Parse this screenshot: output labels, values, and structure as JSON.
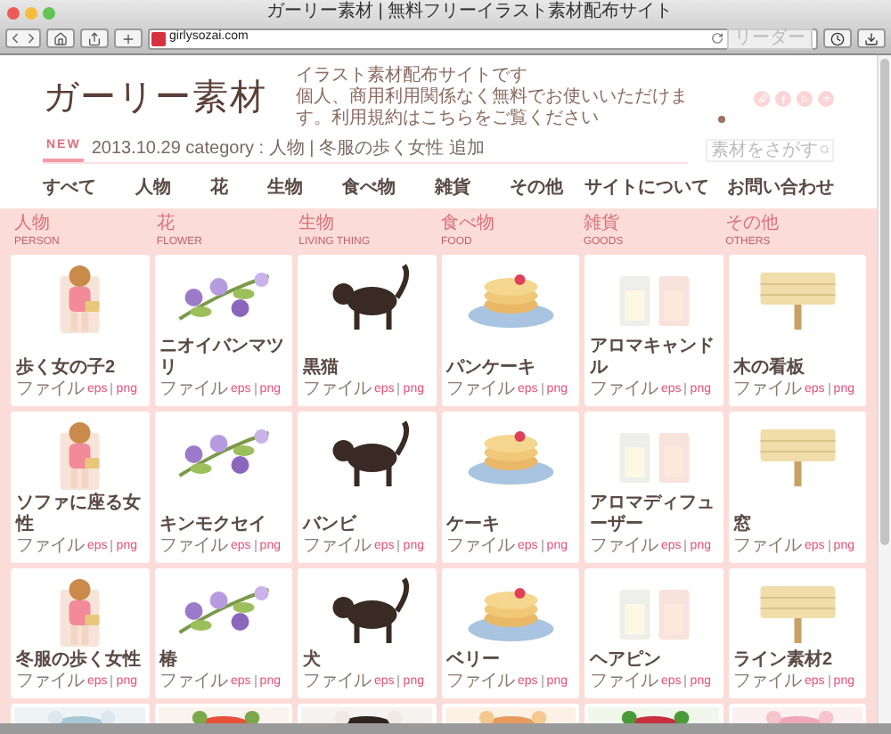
{
  "browser": {
    "title": "ガーリー素材 | 無料フリーイラスト素材配布サイト",
    "url": "girlysozai.com",
    "reader_button": "リーダー"
  },
  "header": {
    "logo": "ガーリー素材",
    "tagline": [
      "イラスト素材配布サイトです",
      "個人、商用利用関係なく無料でお使いいただけます。利用規約はこちらをご覧ください"
    ]
  },
  "news": {
    "badge": "NEW",
    "text": "2013.10.29 category : 人物 | 冬服の歩く女性 追加"
  },
  "search": {
    "placeholder": "素材をさがす"
  },
  "nav": {
    "items": [
      "すべて",
      "人物",
      "花",
      "生物",
      "食べ物",
      "雑貨",
      "その他"
    ],
    "links": [
      "サイトについて",
      "お問い合わせ"
    ]
  },
  "categories": [
    {
      "name": "人物",
      "sub": "PERSON"
    },
    {
      "name": "花",
      "sub": "FLOWER"
    },
    {
      "name": "生物",
      "sub": "LIVING THING"
    },
    {
      "name": "食べ物",
      "sub": "FOOD"
    },
    {
      "name": "雑貨",
      "sub": "GOODS"
    },
    {
      "name": "その他",
      "sub": "OTHERS"
    }
  ],
  "cards": [
    {
      "kind": "item",
      "title": "歩く女の子2",
      "file_label": "ファイル",
      "links": [
        "eps",
        "png"
      ]
    },
    {
      "kind": "item",
      "title": "ニオイバンマツリ",
      "file_label": "ファイル",
      "links": [
        "eps",
        "png"
      ]
    },
    {
      "kind": "item",
      "title": "黒猫",
      "file_label": "ファイル",
      "links": [
        "eps",
        "png"
      ]
    },
    {
      "kind": "item",
      "title": "パンケーキ",
      "file_label": "ファイル",
      "links": [
        "eps",
        "png"
      ]
    },
    {
      "kind": "item",
      "title": "アロマキャンドル",
      "file_label": "ファイル",
      "links": [
        "eps",
        "png"
      ]
    },
    {
      "kind": "item",
      "title": "木の看板",
      "file_label": "ファイル",
      "links": [
        "eps",
        "png"
      ]
    },
    {
      "kind": "item",
      "title": "ソファに座る女性",
      "file_label": "ファイル",
      "links": [
        "eps",
        "png"
      ]
    },
    {
      "kind": "item",
      "title": "キンモクセイ",
      "file_label": "ファイル",
      "links": [
        "eps",
        "png"
      ]
    },
    {
      "kind": "item",
      "title": "バンビ",
      "file_label": "ファイル",
      "links": [
        "eps",
        "png"
      ]
    },
    {
      "kind": "item",
      "title": "ケーキ",
      "file_label": "ファイル",
      "links": [
        "eps",
        "png"
      ]
    },
    {
      "kind": "item",
      "title": "アロマディフューザー",
      "file_label": "ファイル",
      "links": [
        "eps",
        "png"
      ]
    },
    {
      "kind": "item",
      "title": "窓",
      "file_label": "ファイル",
      "links": [
        "eps",
        "png"
      ]
    },
    {
      "kind": "item",
      "title": "冬服の歩く女性",
      "file_label": "ファイル",
      "links": [
        "eps",
        "png"
      ]
    },
    {
      "kind": "item",
      "title": "椿",
      "file_label": "ファイル",
      "links": [
        "eps",
        "png"
      ]
    },
    {
      "kind": "item",
      "title": "犬",
      "file_label": "ファイル",
      "links": [
        "eps",
        "png"
      ]
    },
    {
      "kind": "item",
      "title": "ベリー",
      "file_label": "ファイル",
      "links": [
        "eps",
        "png"
      ]
    },
    {
      "kind": "item",
      "title": "ヘアピン",
      "file_label": "ファイル",
      "links": [
        "eps",
        "png"
      ]
    },
    {
      "kind": "item",
      "title": "ライン素材2",
      "file_label": "ファイル",
      "links": [
        "eps",
        "png"
      ]
    },
    {
      "kind": "partial"
    },
    {
      "kind": "partial"
    },
    {
      "kind": "partial"
    },
    {
      "kind": "partial"
    },
    {
      "kind": "partial"
    },
    {
      "kind": "partial"
    }
  ]
}
